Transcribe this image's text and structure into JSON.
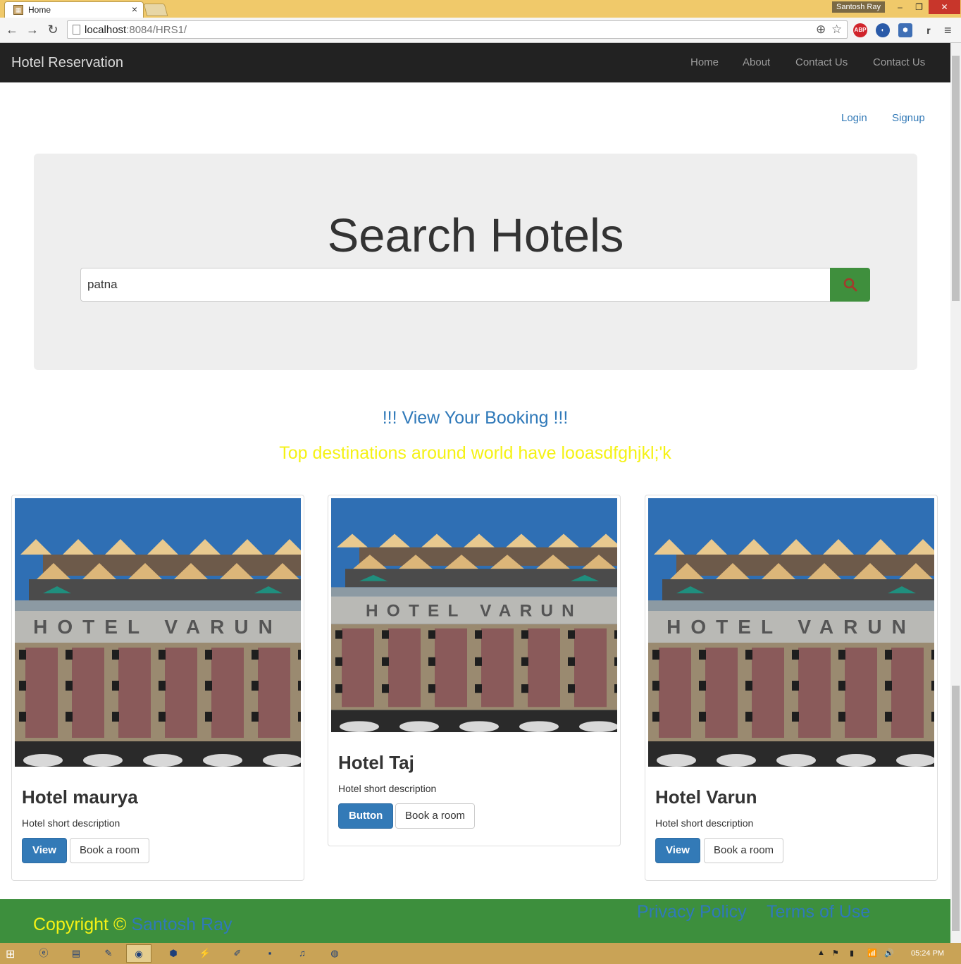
{
  "browser": {
    "tab_title": "Home",
    "tab_close": "×",
    "profile_name": "Santosh Ray",
    "url_host": "localhost",
    "url_rest": ":8084/HRS1/",
    "ext_abp": "ABP",
    "ext_r": "r",
    "win_minimize": "–",
    "win_restore": "❐",
    "win_close": "✕",
    "back": "←",
    "forward": "→",
    "reload": "↻",
    "zoom": "⊕",
    "star": "☆",
    "menu": "≡"
  },
  "navbar": {
    "brand": "Hotel Reservation",
    "links": [
      "Home",
      "About",
      "Contact Us",
      "Contact Us"
    ]
  },
  "auth": {
    "login": "Login",
    "signup": "Signup"
  },
  "search": {
    "title": "Search Hotels",
    "value": "patna"
  },
  "view_booking": "!!! View Your Booking !!!",
  "top_destinations": "Top destinations around world have looasdfghjkl;'k",
  "hotels": [
    {
      "name": "Hotel maurya",
      "desc": "Hotel short description",
      "primary": "View",
      "secondary": "Book a room",
      "sign": "HOTEL VARUN"
    },
    {
      "name": "Hotel Taj",
      "desc": "Hotel short description",
      "primary": "Button",
      "secondary": "Book a room",
      "sign": "HOTEL VARUN"
    },
    {
      "name": "Hotel Varun",
      "desc": "Hotel short description",
      "primary": "View",
      "secondary": "Book a room",
      "sign": "HOTEL VARUN"
    }
  ],
  "footer": {
    "copyright": "Copyright ©",
    "owner": "Santosh Ray",
    "privacy": "Privacy Policy",
    "terms": "Terms of Use"
  },
  "taskbar": {
    "time": "05:24 PM"
  },
  "colors": {
    "navbar_bg": "#222222",
    "primary": "#337ab7",
    "green": "#3d8f3d",
    "yellow": "#f5f215"
  }
}
